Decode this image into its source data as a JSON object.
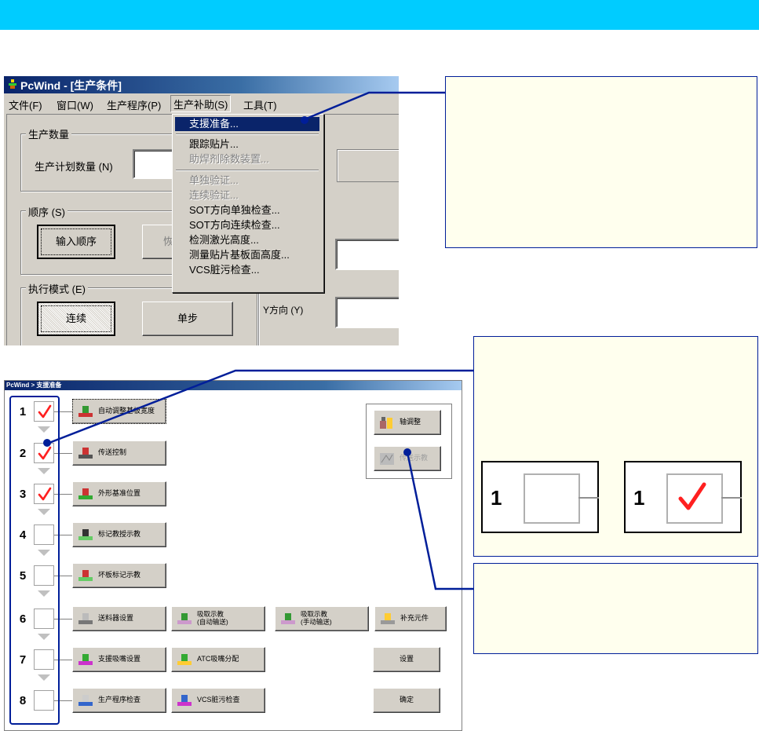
{
  "top_window": {
    "title": "PcWind - [生产条件]",
    "menu": [
      "文件(F)",
      "窗口(W)",
      "生产程序(P)",
      "生产补助(S)",
      "工具(T)"
    ],
    "active_menu_index": 3,
    "group_qty": "生产数量",
    "plan_qty_label": "生产计划数量 (N)",
    "group_order": "顺序 (S)",
    "input_order_button": "输入顺序",
    "order_button_2": "恢",
    "group_mode": "执行模式 (E)",
    "continuous_button": "连续",
    "single_step_button": "单步",
    "y_direction_label": "Y方向 (Y)",
    "dropdown": [
      {
        "label": "支援准备...",
        "state": "highlighted"
      },
      {
        "label": "跟踪贴片...",
        "state": "enabled"
      },
      {
        "label": "助焊剂除数装置...",
        "state": "disabled"
      },
      {
        "label": "单独验证...",
        "state": "disabled"
      },
      {
        "label": "连续验证...",
        "state": "disabled"
      },
      {
        "label": "SOT方向单独检查...",
        "state": "enabled"
      },
      {
        "label": "SOT方向连续检查...",
        "state": "enabled"
      },
      {
        "label": "检测激光高度...",
        "state": "enabled"
      },
      {
        "label": "测量贴片基板面高度...",
        "state": "enabled"
      },
      {
        "label": "VCS脏污检查...",
        "state": "enabled"
      }
    ]
  },
  "bottom_window": {
    "title": "PcWind > 支援准备",
    "steps": [
      {
        "num": "1",
        "checked": true,
        "buttons": [
          {
            "label": "自动调整基板宽度",
            "icon": "width-adjust-icon"
          }
        ]
      },
      {
        "num": "2",
        "checked": true,
        "buttons": [
          {
            "label": "传送控制",
            "icon": "conveyor-icon"
          }
        ]
      },
      {
        "num": "3",
        "checked": true,
        "buttons": [
          {
            "label": "外形基准位置",
            "icon": "board-outline-icon"
          }
        ]
      },
      {
        "num": "4",
        "checked": false,
        "buttons": [
          {
            "label": "标记教授示教",
            "icon": "mark-teach-icon"
          }
        ]
      },
      {
        "num": "5",
        "checked": false,
        "buttons": [
          {
            "label": "坏板标记示教",
            "icon": "bad-mark-icon"
          }
        ]
      },
      {
        "num": "6",
        "checked": false,
        "buttons": [
          {
            "label": "送料器设置",
            "icon": "feeder-icon"
          },
          {
            "label": "吸取示教",
            "label2": "(自动输送)",
            "icon": "pickup-auto-icon"
          },
          {
            "label": "吸取示教",
            "label2": "(手动输送)",
            "icon": "pickup-manual-icon"
          },
          {
            "label": "补充元件",
            "icon": "replenish-icon"
          }
        ]
      },
      {
        "num": "7",
        "checked": false,
        "buttons": [
          {
            "label": "支援吸嘴设置",
            "icon": "support-nozzle-icon"
          },
          {
            "label": "ATC吸嘴分配",
            "icon": "atc-nozzle-icon"
          },
          {
            "label": "设置",
            "icon": ""
          }
        ]
      },
      {
        "num": "8",
        "checked": false,
        "buttons": [
          {
            "label": "生产程序检查",
            "icon": "program-check-icon"
          },
          {
            "label": "VCS脏污检查",
            "icon": "vcs-icon"
          },
          {
            "label": "确定",
            "icon": ""
          }
        ]
      }
    ],
    "side_buttons": [
      {
        "label": "轴调整",
        "icon": "axis-adjust-icon",
        "disabled": false
      },
      {
        "label": "传送示教",
        "icon": "transfer-icon",
        "disabled": true
      }
    ]
  },
  "samples": {
    "left_num": "1",
    "right_num": "1"
  },
  "colors": {
    "banner": "#00ccff",
    "annotation_line": "#001e99",
    "note_bg": "#ffffee",
    "check": "#ff2020",
    "highlight": "#0a246a"
  }
}
